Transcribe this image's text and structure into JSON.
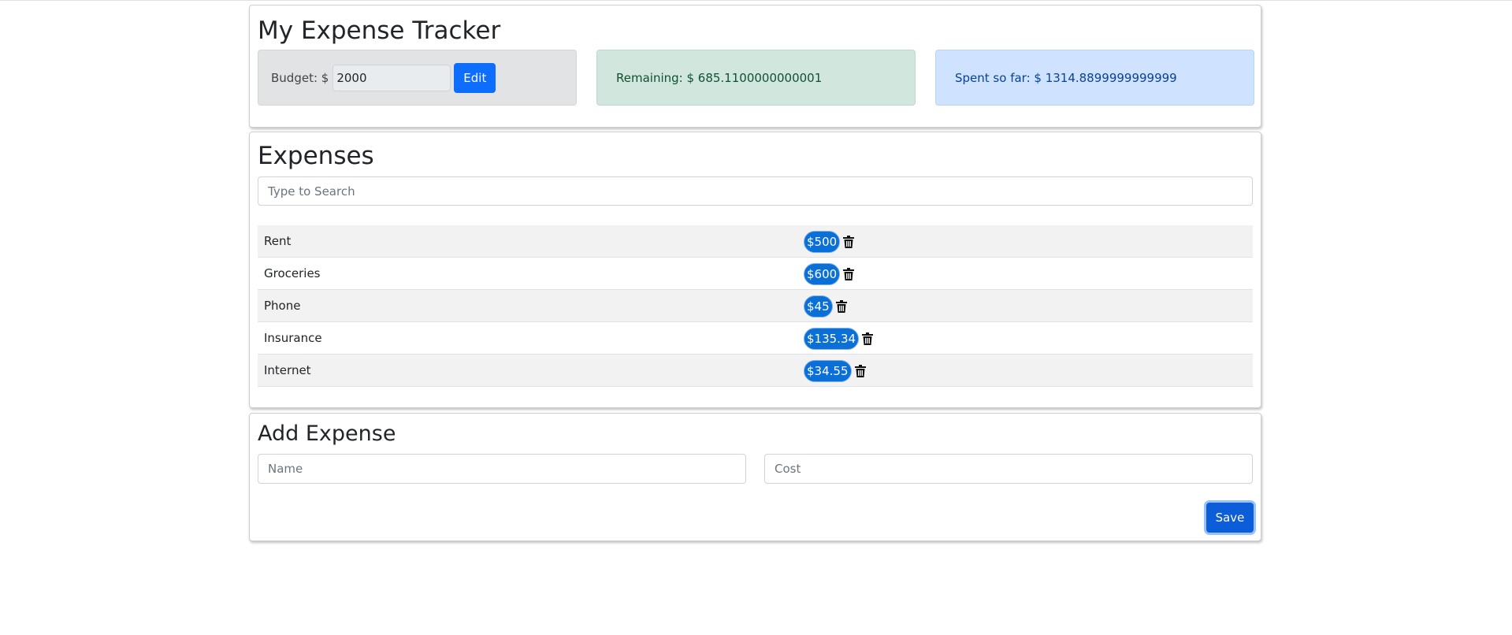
{
  "header": {
    "title": "My Expense Tracker",
    "budget_label": "Budget: $",
    "budget_value": "2000",
    "edit_label": "Edit",
    "remaining_text": "Remaining: $ 685.1100000000001",
    "spent_text": "Spent so far: $ 1314.8899999999999"
  },
  "expenses": {
    "title": "Expenses",
    "search_placeholder": "Type to Search",
    "items": [
      {
        "name": "Rent",
        "cost": "$500"
      },
      {
        "name": "Groceries",
        "cost": "$600"
      },
      {
        "name": "Phone",
        "cost": "$45"
      },
      {
        "name": "Insurance",
        "cost": "$135.34"
      },
      {
        "name": "Internet",
        "cost": "$34.55"
      }
    ],
    "delete_icon": "trash-icon"
  },
  "add_expense": {
    "title": "Add Expense",
    "name_placeholder": "Name",
    "cost_placeholder": "Cost",
    "save_label": "Save"
  },
  "colors": {
    "primary": "#0d6efd",
    "badge": "#0a6fd6",
    "remaining_bg": "#d1e7dd",
    "spent_bg": "#cfe2ff",
    "budget_bg": "#e2e3e5"
  }
}
